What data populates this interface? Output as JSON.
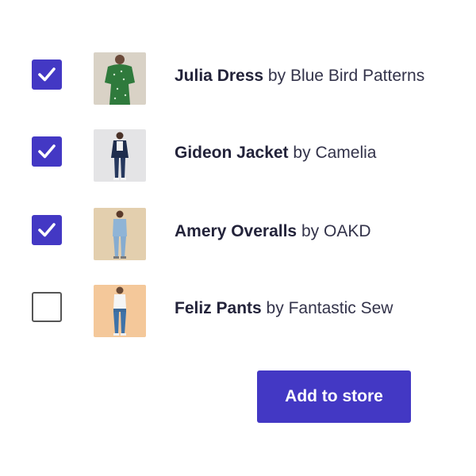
{
  "products": [
    {
      "name": "Julia Dress",
      "by": "by",
      "brand": "Blue Bird Patterns",
      "checked": true,
      "thumb_icon": "green-dress-photo"
    },
    {
      "name": "Gideon Jacket",
      "by": "by",
      "brand": "Camelia",
      "checked": true,
      "thumb_icon": "navy-jacket-photo"
    },
    {
      "name": "Amery Overalls",
      "by": "by",
      "brand": "OAKD",
      "checked": true,
      "thumb_icon": "denim-overalls-photo"
    },
    {
      "name": "Feliz Pants",
      "by": "by",
      "brand": "Fantastic Sew",
      "checked": false,
      "thumb_icon": "blue-pants-photo"
    }
  ],
  "actions": {
    "add_label": "Add to store"
  },
  "colors": {
    "accent": "#4338c4",
    "text": "#33334a"
  }
}
